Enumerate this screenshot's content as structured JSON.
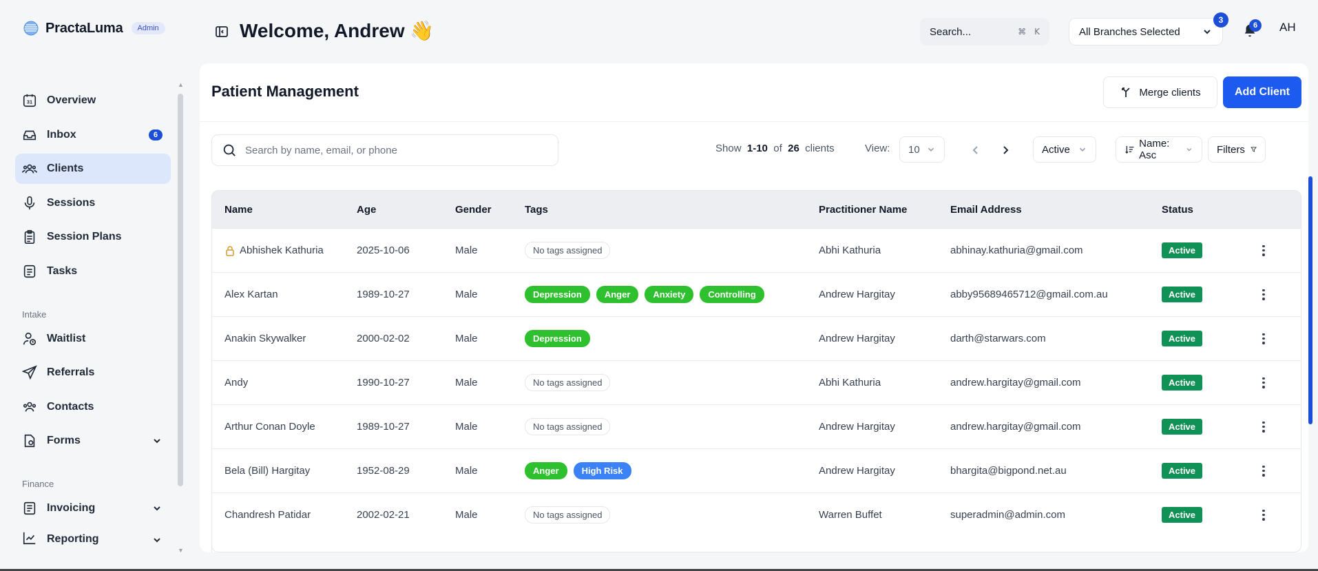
{
  "brand": {
    "name": "PractaLuma",
    "badge": "Admin"
  },
  "sidebar": {
    "items": [
      {
        "label": "Overview",
        "icon": "calendar-icon"
      },
      {
        "label": "Inbox",
        "icon": "inbox-icon",
        "count": "6"
      },
      {
        "label": "Clients",
        "icon": "users-icon",
        "active": true
      },
      {
        "label": "Sessions",
        "icon": "microphone-icon"
      },
      {
        "label": "Session Plans",
        "icon": "clipboard-icon"
      },
      {
        "label": "Tasks",
        "icon": "note-icon"
      }
    ],
    "intake_label": "Intake",
    "intake_items": [
      {
        "label": "Waitlist",
        "icon": "user-clock-icon"
      },
      {
        "label": "Referrals",
        "icon": "send-icon"
      },
      {
        "label": "Contacts",
        "icon": "contacts-icon"
      },
      {
        "label": "Forms",
        "icon": "forms-icon"
      }
    ],
    "finance_label": "Finance",
    "finance_items": [
      {
        "label": "Invoicing",
        "icon": "invoice-icon"
      },
      {
        "label": "Reporting",
        "icon": "chart-icon"
      }
    ]
  },
  "header": {
    "welcome": "Welcome, Andrew 👋",
    "search_label": "Search...",
    "kbd_cmd": "⌘",
    "kbd_key": "K",
    "branch_label": "All Branches Selected",
    "branch_count": "3",
    "notif_count": "6",
    "avatar_initials": "AH"
  },
  "main": {
    "title": "Patient Management",
    "merge_label": "Merge clients",
    "add_label": "Add Client",
    "search_placeholder": "Search by name, email, or phone",
    "show_label": "Show",
    "range": "1-10",
    "of_label": "of",
    "total": "26",
    "clients_label": "clients",
    "view_label": "View:",
    "view_value": "10",
    "status_filter": "Active",
    "sort_label": "Name: Asc",
    "filters_label": "Filters"
  },
  "table": {
    "headers": {
      "name": "Name",
      "age": "Age",
      "gender": "Gender",
      "tags": "Tags",
      "practitioner": "Practitioner Name",
      "email": "Email Address",
      "status": "Status"
    },
    "no_tags_label": "No tags assigned",
    "rows": [
      {
        "name": "Abhishek Kathuria",
        "locked": true,
        "age": "2025-10-06",
        "gender": "Male",
        "tags": [],
        "practitioner": "Abhi Kathuria",
        "email": "abhinay.kathuria@gmail.com",
        "status": "Active"
      },
      {
        "name": "Alex Kartan",
        "age": "1989-10-27",
        "gender": "Male",
        "tags": [
          {
            "label": "Depression",
            "color": "green"
          },
          {
            "label": "Anger",
            "color": "green"
          },
          {
            "label": "Anxiety",
            "color": "green"
          },
          {
            "label": "Controlling",
            "color": "green"
          }
        ],
        "practitioner": "Andrew Hargitay",
        "email": "abby95689465712@gmail.com.au",
        "status": "Active"
      },
      {
        "name": "Anakin Skywalker",
        "age": "2000-02-02",
        "gender": "Male",
        "tags": [
          {
            "label": "Depression",
            "color": "green"
          }
        ],
        "practitioner": "Andrew Hargitay",
        "email": "darth@starwars.com",
        "status": "Active"
      },
      {
        "name": "Andy",
        "age": "1990-10-27",
        "gender": "Male",
        "tags": [],
        "practitioner": "Abhi Kathuria",
        "email": "andrew.hargitay@gmail.com",
        "status": "Active"
      },
      {
        "name": "Arthur Conan Doyle",
        "age": "1989-10-27",
        "gender": "Male",
        "tags": [],
        "practitioner": "Andrew Hargitay",
        "email": "andrew.hargitay@gmail.com",
        "status": "Active"
      },
      {
        "name": "Bela (Bill) Hargitay",
        "age": "1952-08-29",
        "gender": "Male",
        "tags": [
          {
            "label": "Anger",
            "color": "green"
          },
          {
            "label": "High Risk",
            "color": "blue"
          }
        ],
        "practitioner": "Andrew Hargitay",
        "email": "bhargita@bigpond.net.au",
        "status": "Active"
      },
      {
        "name": "Chandresh Patidar",
        "age": "2002-02-21",
        "gender": "Male",
        "tags": [],
        "practitioner": "Warren Buffet",
        "email": "superadmin@admin.com",
        "status": "Active"
      }
    ]
  },
  "colors": {
    "accent": "#1d5bf0",
    "tag_green": "#2ec02e",
    "tag_blue": "#3b82f6",
    "status_active": "#109156"
  }
}
